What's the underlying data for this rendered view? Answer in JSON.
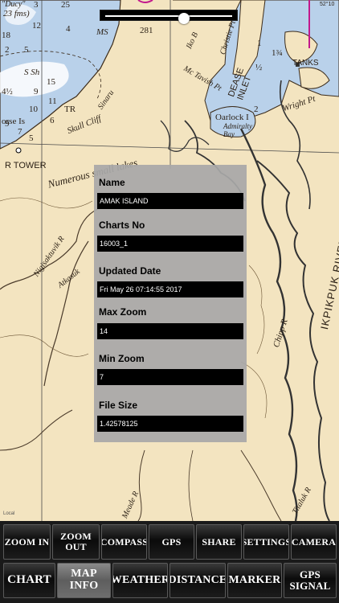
{
  "map": {
    "labels": {
      "buoy": "\"Ducy\"",
      "fms": "23 fms)",
      "ms": "MS",
      "n281": "281",
      "sh": "S Sh",
      "tr": "TR",
      "skull_cliff": "Skull Cliff",
      "sinaru": "Sinaru",
      "r_tower": "R TOWER",
      "numerous_lakes": "Numerous small lakes",
      "iko_b": "Iko B",
      "christie_pt": "Christie Pt",
      "dease_inlet": "DEASE INLET",
      "mc_tavish_pt": "Mc Tavish Pt",
      "tanks": "TANKS",
      "wright_pt": "Wright Pt",
      "oarlock": "Oarlock I",
      "admiralty_bay": "Admiralty Bay",
      "nigisaktuvik": "Nigisaktuvik R",
      "atkasuk": "Atkasuk",
      "chipp_r": "Chipp R",
      "ikpikpuk": "IKPIKPUK RIVER",
      "meade_r": "Meade R",
      "titaluk_r": "Titaluk R",
      "local": "Local",
      "gps_readout": "52°10"
    },
    "soundings": [
      "12",
      "18",
      "25",
      "3",
      "2",
      "5",
      "4½",
      "9",
      "15",
      "11",
      "10",
      "6",
      "9",
      "7",
      "5",
      "4",
      "orse Is",
      "½",
      "1",
      "½",
      "2",
      "1¾"
    ]
  },
  "slider": {
    "value_fraction": 0.62
  },
  "info_panel": {
    "name_label": "Name",
    "name_value": "AMAK ISLAND",
    "charts_no_label": "Charts  No",
    "charts_no_value": "16003_1",
    "updated_label": "Updated Date",
    "updated_value": "Fri May 26 07:14:55 2017",
    "max_zoom_label": "Max Zoom",
    "max_zoom_value": "14",
    "min_zoom_label": "Min Zoom",
    "min_zoom_value": "7",
    "file_size_label": "File Size",
    "file_size_value": "1.42578125"
  },
  "toolbar": {
    "zoom_in": "ZOOM IN",
    "zoom_out": "ZOOM OUT",
    "compass": "COMPASS",
    "gps": "GPS",
    "share": "SHARE",
    "settings": "SETTINGS",
    "camera": "CAMERA",
    "chart": "CHART",
    "map_info": "MAP INFO",
    "weather": "WEATHER",
    "distance": "DISTANCE",
    "marker": "MARKER",
    "gps_signal_line1": "GPS",
    "gps_signal_line2": "SIGNAL",
    "active": "map_info"
  },
  "colors": {
    "land": "#f3e4c0",
    "water": "#b9d1ea",
    "water_deep": "#ffffff",
    "river": "#3a3a3a",
    "panel": "#a8a8a8",
    "toolbar_active": "#7a7a7a",
    "magenta_line": "#c2188c"
  }
}
